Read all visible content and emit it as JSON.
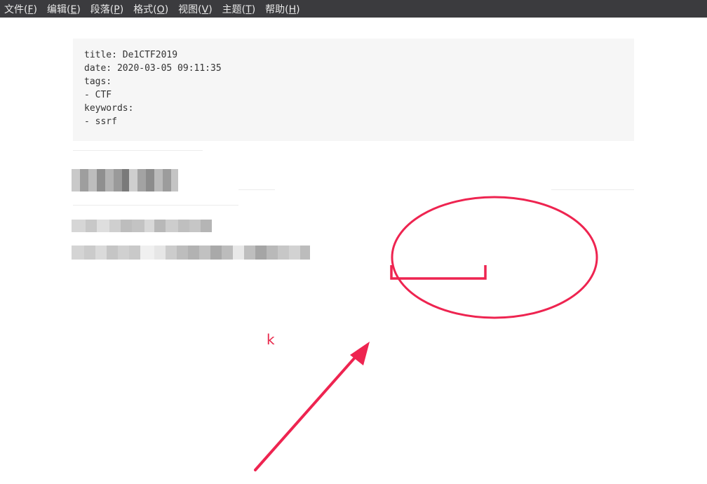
{
  "menubar": {
    "items": [
      {
        "label": "文件(",
        "key": "F",
        "close": ")"
      },
      {
        "label": "编辑(",
        "key": "E",
        "close": ")"
      },
      {
        "label": "段落(",
        "key": "P",
        "close": ")"
      },
      {
        "label": "格式(",
        "key": "O",
        "close": ")"
      },
      {
        "label": "视图(",
        "key": "V",
        "close": ")"
      },
      {
        "label": "主题(",
        "key": "T",
        "close": ")"
      },
      {
        "label": "帮助(",
        "key": "H",
        "close": ")"
      }
    ]
  },
  "front_matter": {
    "lines": [
      "title: De1CTF2019",
      "date: 2020-03-05 09:11:35",
      "tags:",
      "- CTF",
      "keywords:",
      "- ssrf"
    ]
  },
  "editor": {
    "cursor_text": "k"
  },
  "colors": {
    "menubar_bg": "#3b3b3e",
    "annotation": "#ee2450"
  }
}
